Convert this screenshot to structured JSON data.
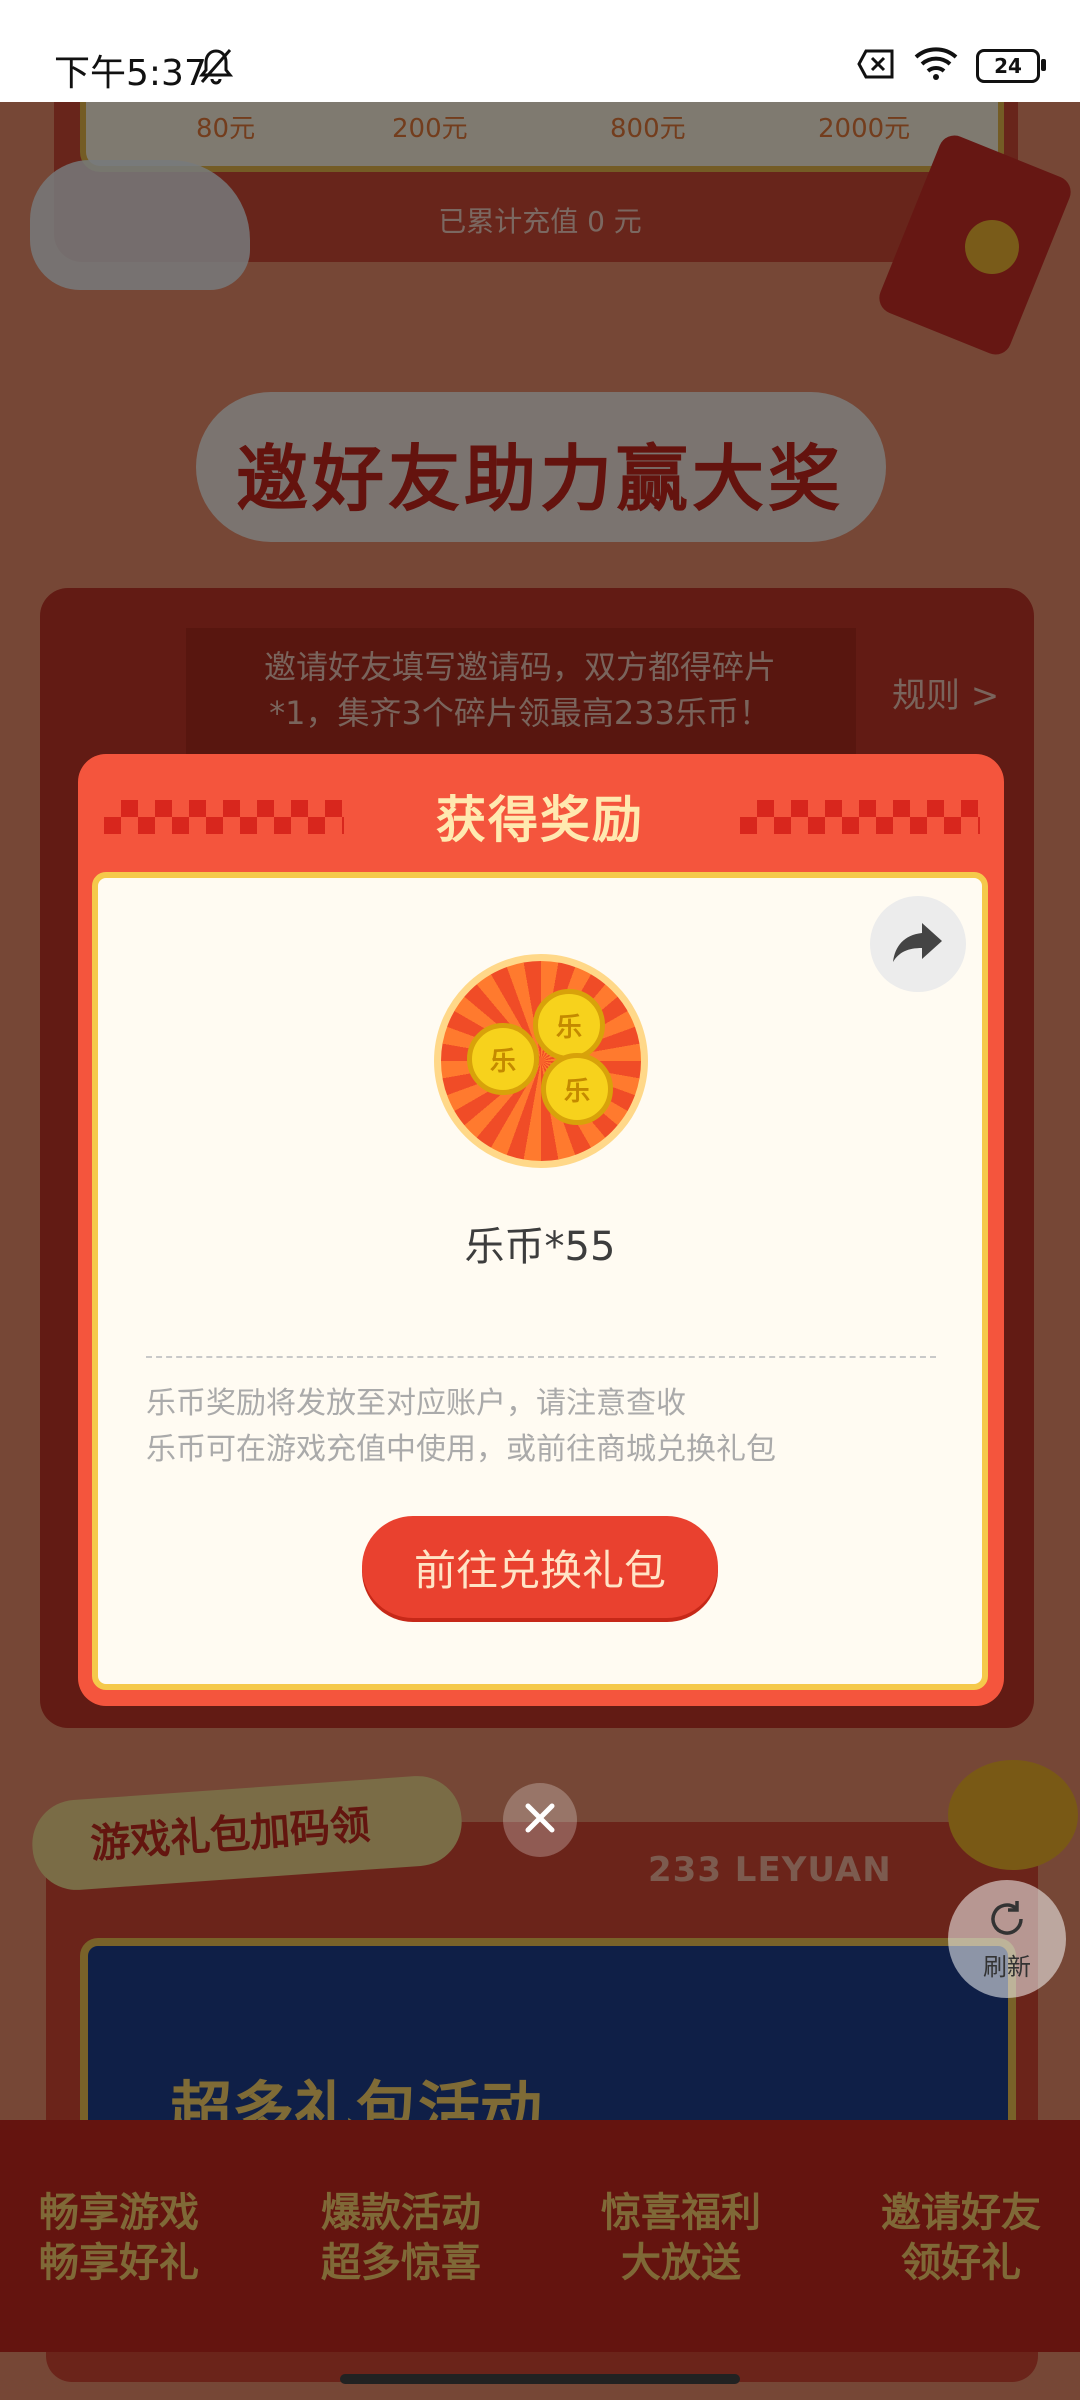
{
  "status_bar": {
    "time": "下午5:37",
    "battery": "24"
  },
  "recharge": {
    "tiers": [
      "80元",
      "200元",
      "800元",
      "2000元"
    ],
    "accumulated": "已累计充值 0 元"
  },
  "invite_section": {
    "title": "邀好友助力赢大奖",
    "description_line1": "邀请好友填写邀请码，双方都得碎片",
    "description_line2": "*1，集齐3个碎片领最高233乐币！",
    "rules_link": "规则 >"
  },
  "gift_section": {
    "tag": "游戏礼包加码领",
    "brand": "233 LEYUAN",
    "banner_title": "超多礼包活动"
  },
  "bottom_nav": [
    {
      "line1": "畅享游戏",
      "line2": "畅享好礼"
    },
    {
      "line1": "爆款活动",
      "line2": "超多惊喜"
    },
    {
      "line1": "惊喜福利",
      "line2": "大放送"
    },
    {
      "line1": "邀请好友",
      "line2": "领好礼"
    }
  ],
  "modal": {
    "title": "获得奖励",
    "reward_name": "乐币*55",
    "coin_glyph": "乐",
    "note_line1": "乐币奖励将发放至对应账户，请注意查收",
    "note_line2": "乐币可在游戏充值中使用，或前往商城兑换礼包",
    "redeem_button": "前往兑换礼包"
  },
  "refresh": {
    "label": "刷新"
  },
  "icons": {
    "share": "share-arrow-icon",
    "close": "close-icon",
    "refresh": "refresh-icon",
    "bell_off": "bell-off-icon",
    "wifi": "wifi-icon",
    "sim": "no-sim-icon",
    "battery": "battery-icon"
  },
  "colors": {
    "modal_header": "#f4553d",
    "modal_body": "#fffbf2",
    "modal_border": "#f5c94b",
    "button": "#e9412f",
    "title_text": "#ffe9b0"
  }
}
